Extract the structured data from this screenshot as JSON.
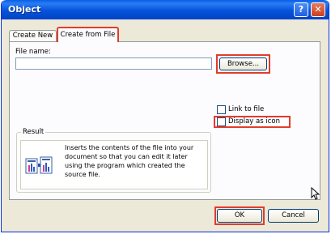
{
  "window": {
    "title": "Object"
  },
  "titlebar": {
    "help_label": "?",
    "close_label": "✕"
  },
  "tabs": [
    {
      "label": "Create New",
      "active": false
    },
    {
      "label": "Create from File",
      "active": true
    }
  ],
  "file": {
    "label": "File name:",
    "value": ""
  },
  "browse_button": {
    "label": "Browse..."
  },
  "options": {
    "link_to_file": {
      "label": "Link to file",
      "checked": false
    },
    "display_as_icon": {
      "label": "Display as icon",
      "checked": false
    }
  },
  "result": {
    "legend": "Result",
    "lines": [
      "Inserts the contents of the file into your",
      "document so that you can edit it later",
      "using the program which created the",
      "source file."
    ]
  },
  "buttons": {
    "ok": "OK",
    "cancel": "Cancel"
  },
  "colors": {
    "highlight": "#e23c2c",
    "titlebar": "#0653da",
    "dialog_bg": "#ece9d8"
  }
}
